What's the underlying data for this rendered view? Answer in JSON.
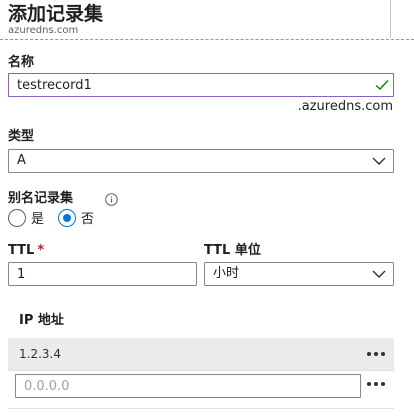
{
  "header": {
    "title": "添加记录集",
    "subtitle": "azuredns.com"
  },
  "name_field": {
    "label": "名称",
    "value": "testrecord1",
    "suffix": ".azuredns.com"
  },
  "type_field": {
    "label": "类型",
    "selected": "A"
  },
  "alias": {
    "label": "别名记录集",
    "options": [
      "是",
      "否"
    ],
    "selected": "否"
  },
  "ttl": {
    "label": "TTL",
    "required_mark": "*",
    "value": "1"
  },
  "ttl_unit": {
    "label": "TTL 单位",
    "selected": "小时"
  },
  "ip": {
    "header": "IP 地址",
    "rows": [
      "1.2.3.4"
    ],
    "new_placeholder": "0.0.0.0"
  },
  "colors": {
    "accent": "#0078d4",
    "focus_border": "#8764b8",
    "valid": "#107c10",
    "required": "#a4262c"
  }
}
